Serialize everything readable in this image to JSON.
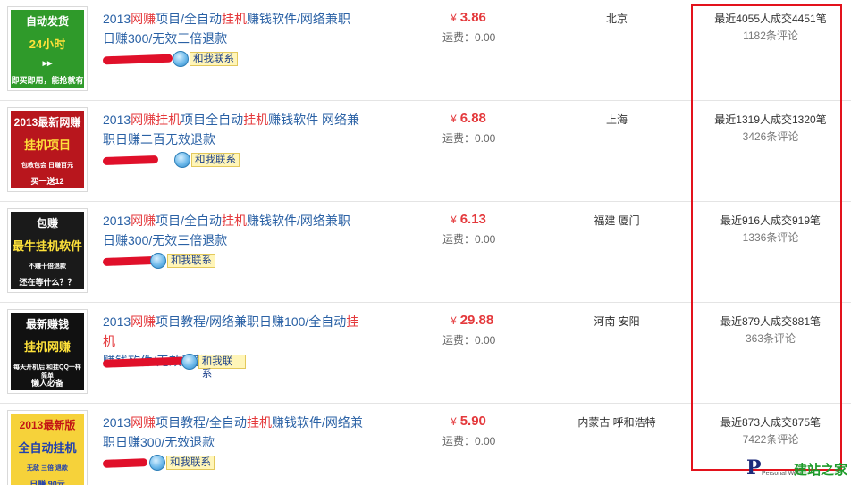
{
  "listings": [
    {
      "title_parts": [
        "2013",
        "网赚",
        "项目/全自动",
        "挂机",
        "赚钱软件/网络兼职",
        "日赚300/无效三倍退款"
      ],
      "title_break": 4,
      "contact_label": "和我联系",
      "price": "3.86",
      "currency": "¥",
      "shipping": "运费：0.00",
      "location": "北京",
      "deal": "最近4055人成交4451笔",
      "reviews": "1182条评论",
      "thumb_text": [
        "自动发货",
        "24小时",
        "▶▶",
        "即买即用，能抢就有货"
      ],
      "thumb_bg": "#2f9a2a"
    },
    {
      "title_parts": [
        "2013",
        "网赚",
        "挂机",
        "项目全自动",
        "挂机",
        "赚钱软件 网络兼",
        "职日赚二百无效退款"
      ],
      "title_break": 5,
      "contact_label": "和我联系",
      "price": "6.88",
      "currency": "¥",
      "shipping": "运费：0.00",
      "location": "上海",
      "deal": "最近1319人成交1320笔",
      "reviews": "3426条评论",
      "thumb_text": [
        "2013最新网赚",
        "挂机项目",
        "包教包会 日赚百元",
        "买一送12"
      ],
      "thumb_bg": "#b8161d"
    },
    {
      "title_parts": [
        "2013",
        "网赚",
        "项目/全自动",
        "挂机",
        "赚钱软件/网络兼职",
        "日赚300/无效三倍退款"
      ],
      "title_break": 4,
      "contact_label": "和我联系",
      "price": "6.13",
      "currency": "¥",
      "shipping": "运费：0.00",
      "location": "福建 厦门",
      "deal": "最近916人成交919笔",
      "reviews": "1336条评论",
      "thumb_text": [
        "包赚",
        "最牛挂机软件",
        "不赚十倍退款",
        "还在等什么？？"
      ],
      "thumb_bg": "#1a1a1a"
    },
    {
      "title_parts": [
        "2013",
        "网赚",
        "项目教程/网络兼职日赚100/全自动",
        "挂",
        "机",
        "赚钱软件/无效退款"
      ],
      "title_break": 4,
      "contact_label": "和我联系",
      "price": "29.88",
      "currency": "¥",
      "shipping": "运费：0.00",
      "location": "河南 安阳",
      "deal": "最近879人成交881笔",
      "reviews": "363条评论",
      "thumb_text": [
        "最新赚钱",
        "挂机网赚",
        "每天开机后 和挂QQ一样简单",
        "懒人必备"
      ],
      "thumb_bg": "#111111"
    },
    {
      "title_parts": [
        "2013",
        "网赚",
        "项目教程/全自动",
        "挂机",
        "赚钱软件/网络",
        "兼职日赚300/无效退款"
      ],
      "title_break": 5,
      "contact_label": "和我联系",
      "price": "5.90",
      "currency": "¥",
      "shipping": "运费：0.00",
      "location": "内蒙古 呼和浩特",
      "deal": "最近873人成交875笔",
      "reviews": "7422条评论",
      "thumb_text": [
        "2013最新版",
        "全自动挂机",
        "无敌 三倍 退款",
        "日赚 90元"
      ],
      "thumb_bg": "#f6d23a"
    }
  ],
  "watermark": {
    "letter": "P",
    "small": "Personal Web",
    "name": "建站之家"
  },
  "colors": {
    "title_link": "#2a61a5",
    "keyword": "#e4393c",
    "price": "#e4393c",
    "highlight_box": "#e3121c"
  }
}
